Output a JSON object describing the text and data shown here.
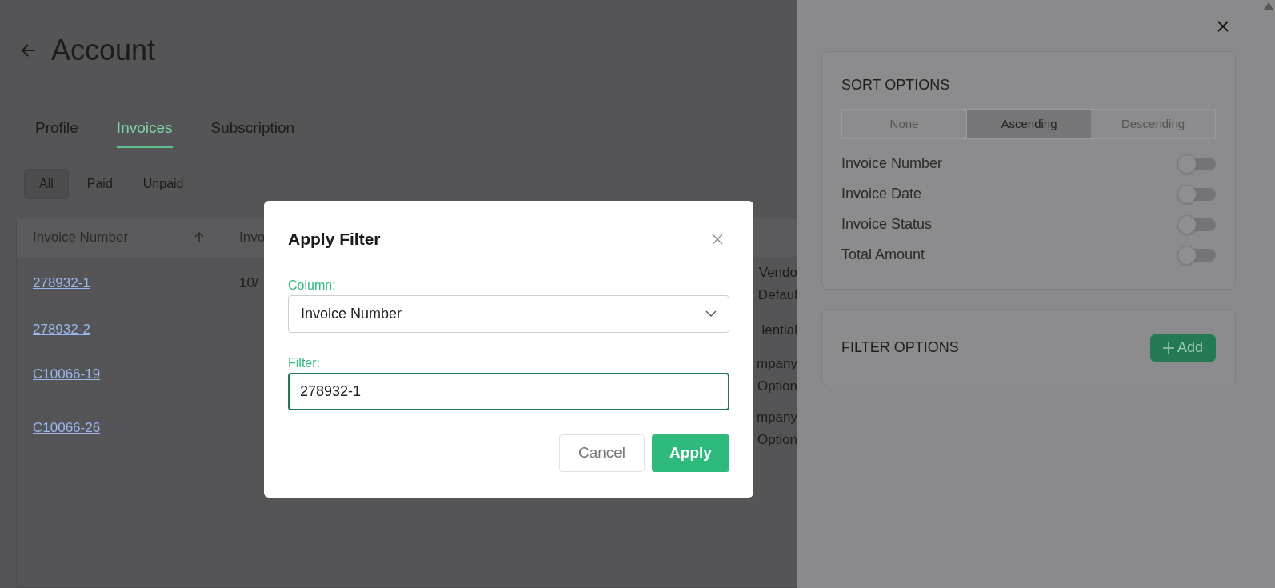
{
  "page": {
    "title": "Account"
  },
  "tabs": [
    {
      "label": "Profile",
      "selected": false
    },
    {
      "label": "Invoices",
      "selected": true
    },
    {
      "label": "Subscription",
      "selected": false
    }
  ],
  "status_filters": [
    {
      "label": "All",
      "selected": true
    },
    {
      "label": "Paid",
      "selected": false
    },
    {
      "label": "Unpaid",
      "selected": false
    }
  ],
  "table": {
    "columns": [
      "Invoice Number",
      "Invo"
    ],
    "rows": [
      {
        "invoice_number": "278932-1",
        "column_2": "10/",
        "column_3": [
          "Vendo",
          "Defaul"
        ]
      },
      {
        "invoice_number": "278932-2",
        "column_2": "",
        "column_3": [
          "lential"
        ]
      },
      {
        "invoice_number": "C10066-19",
        "column_2": "",
        "column_3": [
          "mpany",
          "Option"
        ]
      },
      {
        "invoice_number": "C10066-26",
        "column_2": "",
        "column_3": [
          "mpany",
          "Option"
        ]
      }
    ]
  },
  "dialog": {
    "title": "Apply Filter",
    "column_label": "Column:",
    "column_value": "Invoice Number",
    "filter_label": "Filter:",
    "filter_value": "278932-1",
    "buttons": [
      "Cancel",
      "Apply"
    ]
  },
  "side_panel": {
    "sort_title": "SORT OPTIONS",
    "sort_modes": [
      {
        "label": "None",
        "selected": false
      },
      {
        "label": "Ascending",
        "selected": true
      },
      {
        "label": "Descending",
        "selected": false
      }
    ],
    "sort_fields": [
      {
        "label": "Invoice Number",
        "on": false
      },
      {
        "label": "Invoice Date",
        "on": false
      },
      {
        "label": "Invoice Status",
        "on": false
      },
      {
        "label": "Total Amount",
        "on": false
      }
    ],
    "filter_title": "FILTER OPTIONS",
    "add_button": "Add"
  }
}
